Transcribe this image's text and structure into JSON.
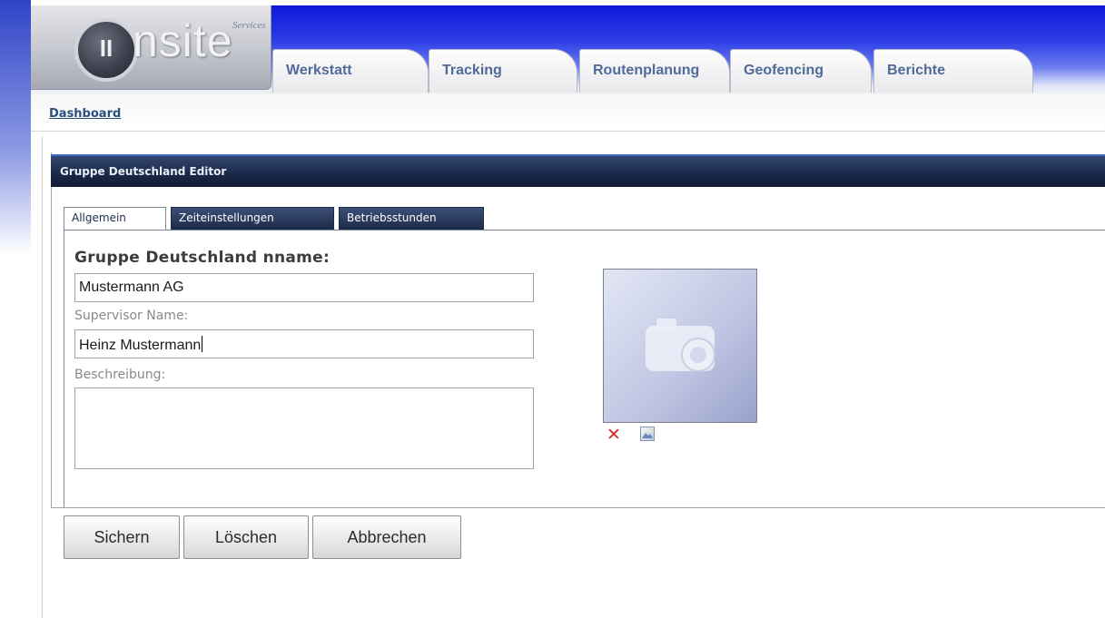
{
  "header": {
    "logo_text": "nsite",
    "logo_mark": "II",
    "logo_subtitle": "Services"
  },
  "main_tabs": [
    {
      "label": "Werkstatt"
    },
    {
      "label": "Tracking"
    },
    {
      "label": "Routenplanung"
    },
    {
      "label": "Geofencing"
    },
    {
      "label": "Berichte"
    }
  ],
  "breadcrumb": {
    "label": "Dashboard"
  },
  "editor": {
    "title": "Gruppe Deutschland Editor",
    "tabs": [
      {
        "label": "Allgemein",
        "active": true
      },
      {
        "label": "Zeiteinstellungen",
        "active": false
      },
      {
        "label": "Betriebsstunden",
        "active": false
      }
    ],
    "form": {
      "group_name_label": "Gruppe Deutschland nname:",
      "group_name_value": "Mustermann AG",
      "supervisor_label": "Supervisor Name:",
      "supervisor_value": "Heinz Mustermann",
      "description_label": "Beschreibung:",
      "description_value": ""
    },
    "photo": {
      "placeholder_icon": "camera-icon",
      "delete_icon": "delete-x-icon",
      "upload_icon": "image-upload-icon"
    }
  },
  "actions": {
    "save_label": "Sichern",
    "delete_label": "Löschen",
    "cancel_label": "Abbrechen"
  },
  "colors": {
    "header_blue": "#0f17d8",
    "panel_title": "#1b2b4c",
    "link": "#2a4f80",
    "delete_red": "#d02a2a"
  }
}
